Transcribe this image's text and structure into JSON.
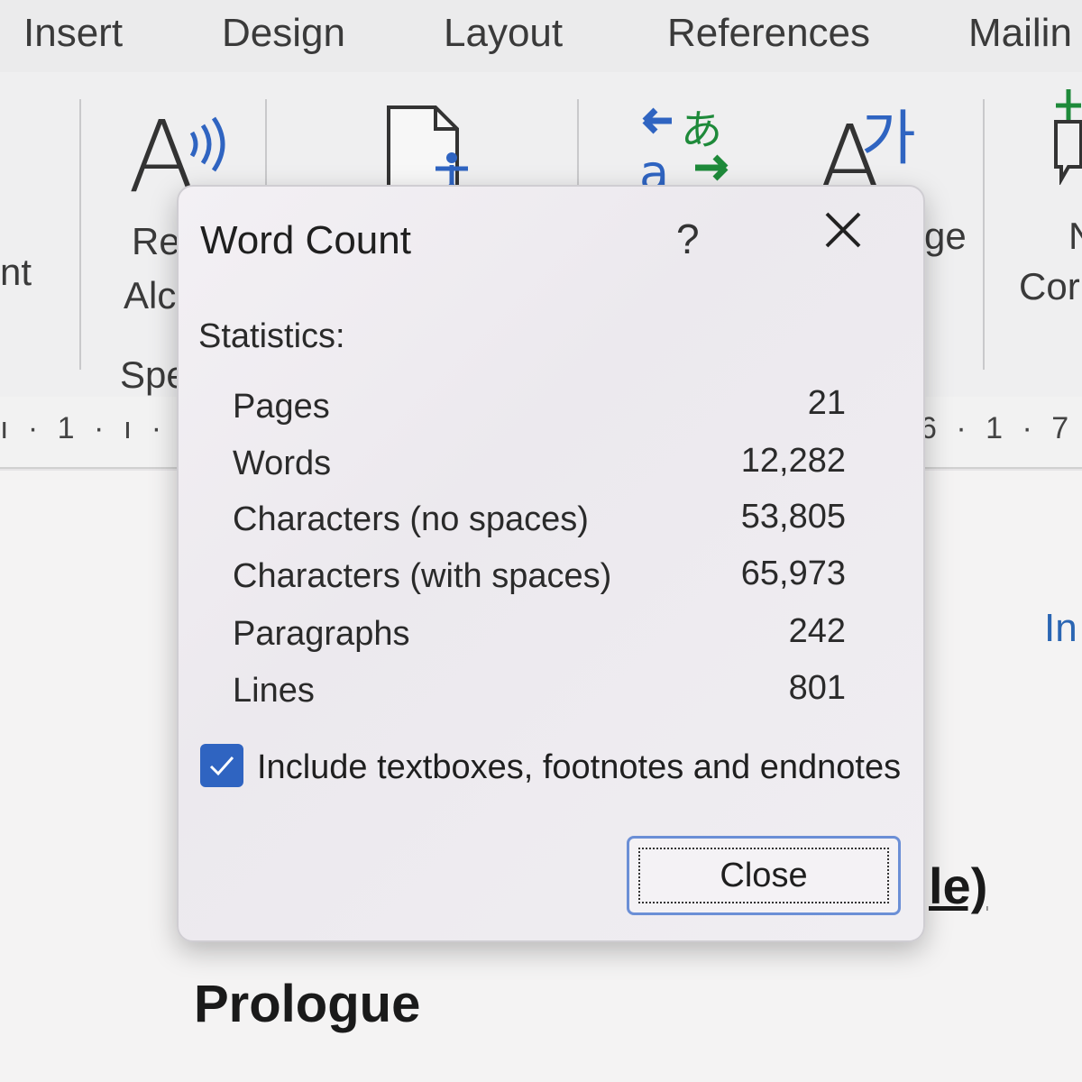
{
  "ribbon": {
    "tabs": [
      {
        "label": "Insert"
      },
      {
        "label": "Design"
      },
      {
        "label": "Layout"
      },
      {
        "label": "References"
      },
      {
        "label": "Mailin"
      }
    ],
    "fragments": {
      "left_nt": "nt",
      "read_re": "Re",
      "read_alo": "Alc",
      "speech_group": "Spe",
      "language_ge": "ge",
      "new_comment_n": "N",
      "new_comment_cor": "Cor",
      "korean_glyph": "가",
      "japanese_glyph": "あ",
      "a_glyph": "a"
    }
  },
  "ruler": {
    "left": "1",
    "right": "6 · 1 · 7"
  },
  "document": {
    "heading": "Prologue",
    "fragment": "le)",
    "link_fragment": "In"
  },
  "dialog": {
    "title": "Word Count",
    "help": "?",
    "statistics_label": "Statistics:",
    "rows": [
      {
        "label": "Pages",
        "value": "21"
      },
      {
        "label": "Words",
        "value": "12,282"
      },
      {
        "label": "Characters (no spaces)",
        "value": "53,805"
      },
      {
        "label": "Characters (with spaces)",
        "value": "65,973"
      },
      {
        "label": "Paragraphs",
        "value": "242"
      },
      {
        "label": "Lines",
        "value": "801"
      }
    ],
    "checkbox": {
      "checked": true,
      "label": "Include textboxes, footnotes and endnotes"
    },
    "close_button": "Close"
  },
  "colors": {
    "accent": "#2f64c1",
    "button_border": "#6b8fd6",
    "link": "#2b66b3"
  }
}
